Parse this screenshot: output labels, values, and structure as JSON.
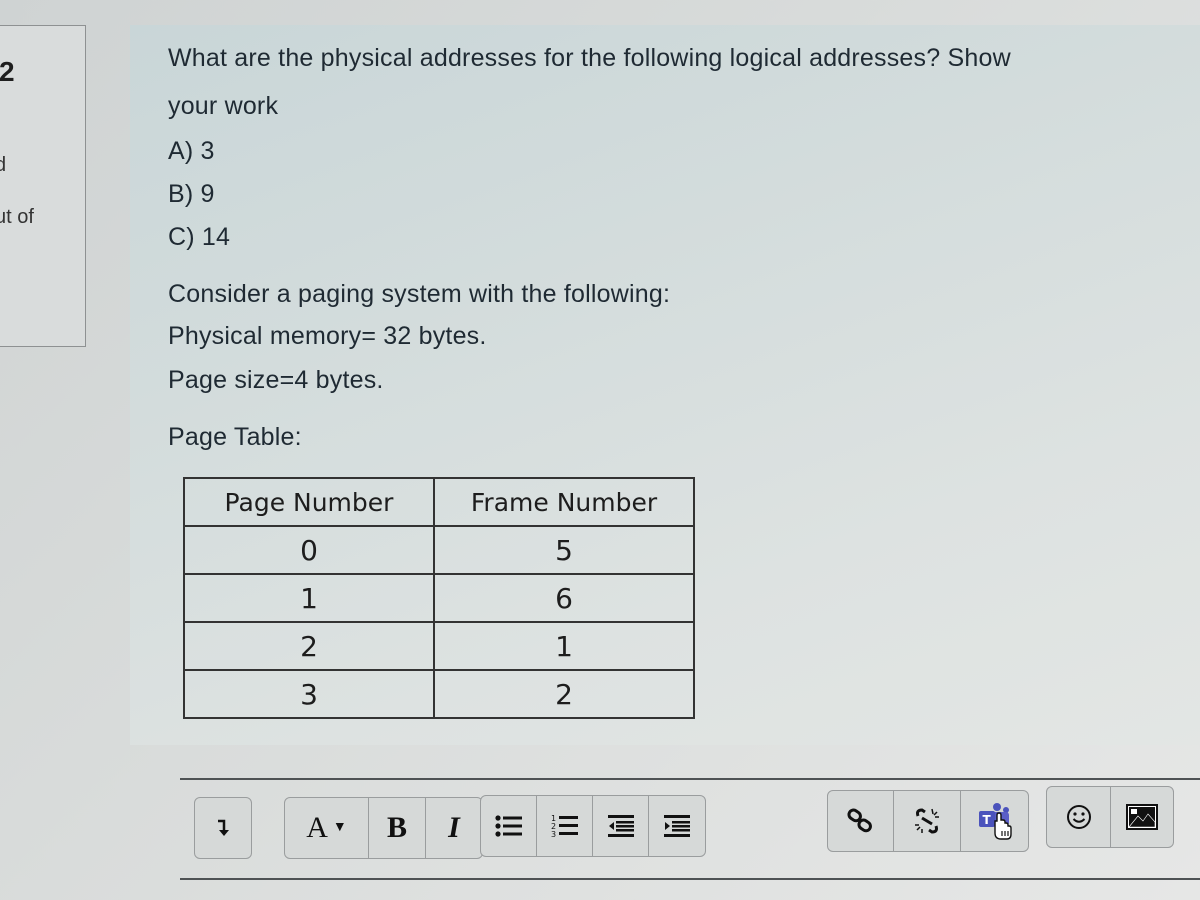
{
  "sidebar": {
    "question_number": "2",
    "status_fragment": "d",
    "grade_fragment": "ut of"
  },
  "question": {
    "line1": "What are the physical addresses for the following logical addresses? Show",
    "line2": "your work",
    "options": [
      "A) 3",
      "B) 9",
      "C) 14"
    ],
    "context_intro": "Consider a paging system with the following:",
    "physical_memory": "Physical memory= 32 bytes.",
    "page_size": "Page size=4 bytes.",
    "page_table_label": "Page Table:"
  },
  "page_table": {
    "headers": [
      "Page Number",
      "Frame Number"
    ],
    "rows": [
      [
        "0",
        "5"
      ],
      [
        "1",
        "6"
      ],
      [
        "2",
        "1"
      ],
      [
        "3",
        "2"
      ]
    ]
  },
  "toolbar": {
    "groups": [
      [
        {
          "icon": "toggle-toolbar-icon"
        }
      ],
      [
        {
          "icon": "font-color-icon",
          "label": "A"
        },
        {
          "icon": "bold-icon",
          "label": "B"
        },
        {
          "icon": "italic-icon",
          "label": "I"
        }
      ],
      [
        {
          "icon": "unordered-list-icon"
        },
        {
          "icon": "ordered-list-icon"
        },
        {
          "icon": "outdent-icon"
        },
        {
          "icon": "indent-icon"
        }
      ],
      [
        {
          "icon": "link-icon"
        },
        {
          "icon": "unlink-icon"
        },
        {
          "icon": "teams-icon"
        }
      ],
      [
        {
          "icon": "emoji-icon"
        },
        {
          "icon": "image-icon"
        }
      ]
    ],
    "teams_color": "#4b53bc"
  }
}
